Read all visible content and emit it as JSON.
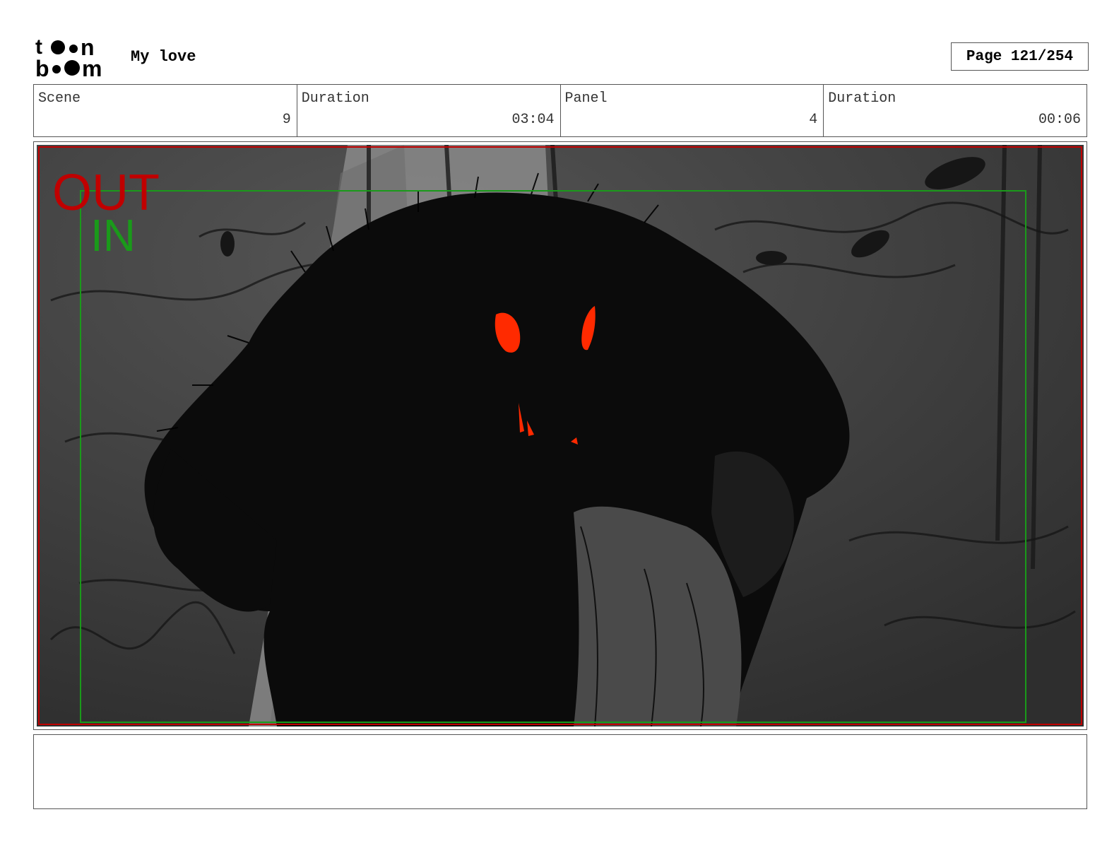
{
  "header": {
    "logo": {
      "line1": "toon",
      "line2": "boom"
    },
    "project_title": "My love",
    "page_label": "Page 121/254"
  },
  "info": [
    {
      "label": "Scene",
      "value": "9"
    },
    {
      "label": "Duration",
      "value": "03:04"
    },
    {
      "label": "Panel",
      "value": "4"
    },
    {
      "label": "Duration",
      "value": "00:06"
    }
  ],
  "panel": {
    "safe_area_labels": {
      "out": "OUT",
      "in": "IN"
    },
    "colors": {
      "out": "#c00000",
      "in": "#1a9a1a",
      "eyes": "#ff2a00",
      "background": "#3b3b3b"
    }
  },
  "caption": {
    "text": ""
  }
}
